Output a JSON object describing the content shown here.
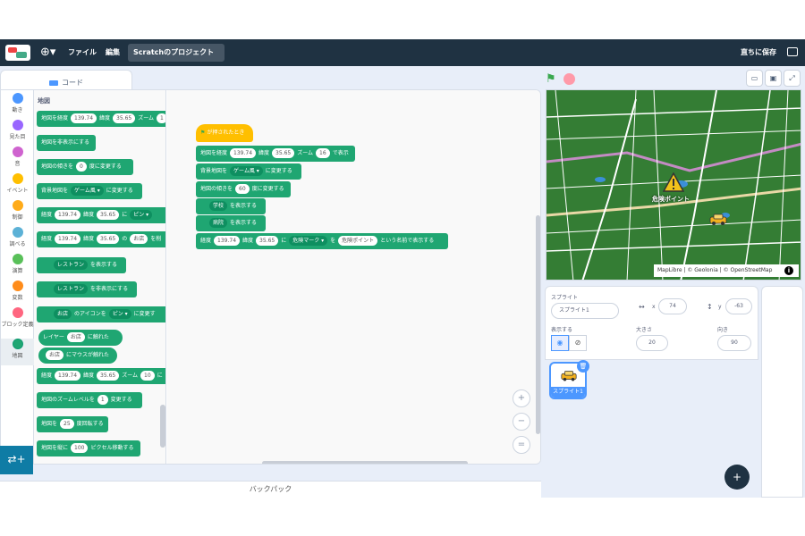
{
  "menubar": {
    "file": "ファイル",
    "edit": "編集",
    "project_title": "Scratchのプロジェクト",
    "save_now": "直ちに保存"
  },
  "tabs": {
    "code": "コード"
  },
  "categories": [
    {
      "label": "動き",
      "color": "#4c97ff"
    },
    {
      "label": "見た目",
      "color": "#9966ff"
    },
    {
      "label": "音",
      "color": "#cf63cf"
    },
    {
      "label": "イベント",
      "color": "#ffbf00"
    },
    {
      "label": "制御",
      "color": "#ffab19"
    },
    {
      "label": "調べる",
      "color": "#5cb1d6"
    },
    {
      "label": "演算",
      "color": "#59c059"
    },
    {
      "label": "変数",
      "color": "#ff8c1a"
    },
    {
      "label": "ブロック定義",
      "color": "#ff6680"
    },
    {
      "label": "地図",
      "color": "#1fa672"
    }
  ],
  "palette": {
    "title": "地図",
    "blocks": {
      "b1_a": "地図を経度",
      "b1_lon": "139.74",
      "b1_b": "緯度",
      "b1_lat": "35.65",
      "b1_c": "ズーム",
      "b1_zoom": "1",
      "b2": "地図を非表示にする",
      "b3_a": "地図の傾きを",
      "b3_v": "0",
      "b3_b": "度に変更する",
      "b4_a": "背景地図を",
      "b4_v": "ゲーム風 ▾",
      "b4_b": "に変更する",
      "b5_a": "経度",
      "b5_lon": "139.74",
      "b5_b": "緯度",
      "b5_lat": "35.65",
      "b5_c": "に",
      "b5_v": "ピン ▾",
      "b6_a": "経度",
      "b6_lon": "139.74",
      "b6_b": "緯度",
      "b6_lat": "35.65",
      "b6_c": "の",
      "b6_v": "お店",
      "b6_d": "を削",
      "b7_v": "レストラン",
      "b7_b": "を表示する",
      "b8_v": "レストラン",
      "b8_b": "を非表示にする",
      "b9_v": "お店",
      "b9_b": "のアイコンを",
      "b9_v2": "ピン ▾",
      "b9_c": "に変更す",
      "b10_a": "レイヤー",
      "b10_v": "お店",
      "b10_b": "に触れた",
      "b11_v": "お店",
      "b11_b": "にマウスが触れた",
      "b12_a": "経度",
      "b12_lon": "139.74",
      "b12_b": "緯度",
      "b12_lat": "35.65",
      "b12_c": "ズーム",
      "b12_zoom": "10",
      "b12_d": "に",
      "b13_a": "地図のズームレベルを",
      "b13_v": "1",
      "b13_b": "変更する",
      "b14_a": "地図を",
      "b14_v": "25",
      "b14_b": "度回転する",
      "b15_a": "地図を縦に",
      "b15_v": "100",
      "b15_b": "ピクセル移動する"
    }
  },
  "script": {
    "hat": "が押されたとき",
    "s1_a": "地図を経度",
    "s1_lon": "139.74",
    "s1_b": "緯度",
    "s1_lat": "35.65",
    "s1_c": "ズーム",
    "s1_zoom": "16",
    "s1_d": "で表示",
    "s2_a": "背景地図を",
    "s2_v": "ゲーム風 ▾",
    "s2_b": "に変更する",
    "s3_a": "地図の傾きを",
    "s3_v": "60",
    "s3_b": "度に変更する",
    "s4_v": "学校",
    "s4_b": "を表示する",
    "s5_v": "病院",
    "s5_b": "を表示する",
    "s6_a": "経度",
    "s6_lon": "139.74",
    "s6_b": "緯度",
    "s6_lat": "35.65",
    "s6_c": "に",
    "s6_v": "危険マーク ▾",
    "s6_d": "を",
    "s6_v2": "危険ポイント",
    "s6_e": "という名前で表示する"
  },
  "backpack": "バックパック",
  "stage": {
    "marker_label": "危険ポイント",
    "attribution": "MapLibre | © Geolonia | © OpenStreetMap"
  },
  "sprite_info": {
    "sprite_label": "スプライト",
    "sprite_name": "スプライト1",
    "x_label": "x",
    "x_value": "74",
    "y_label": "y",
    "y_value": "-63",
    "show_label": "表示する",
    "size_label": "大きさ",
    "size_value": "20",
    "direction_label": "向き",
    "direction_value": "90"
  },
  "sprite_list": [
    {
      "name": "スプライト1"
    }
  ]
}
